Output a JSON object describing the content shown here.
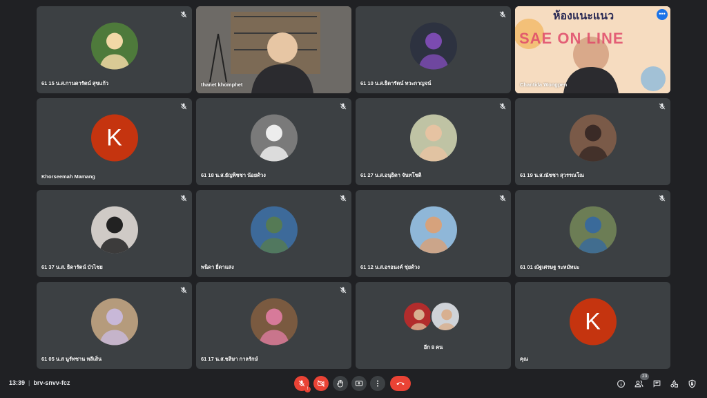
{
  "meeting": {
    "time": "13:39",
    "code": "brv-snvv-fcz"
  },
  "participants": [
    {
      "name": "61 15 น.ส.กานดารัตน์ สุขแก้ว",
      "kind": "photo",
      "bg": "#4e7a3b",
      "fg": "#f2d8a6",
      "muted": true
    },
    {
      "name": "thanet khomphet",
      "kind": "video",
      "bg": "#6d6a66",
      "fg": "#e7c6a4",
      "muted": false
    },
    {
      "name": "61 10 น.ส.ธิดารัตน์ ทวะกาญจน์",
      "kind": "photo",
      "bg": "#2d3240",
      "fg": "#7b4bb0",
      "muted": true
    },
    {
      "name": "Chantida Wongpen",
      "kind": "video",
      "bg": "#f3d6b4",
      "fg": "#d9a98a",
      "muted": false,
      "active": true,
      "banner": "ห้องแนะแนว",
      "banner_sub": "SAE ON LINE"
    },
    {
      "name": "Khorseemah Mamang",
      "kind": "letter",
      "letter": "K",
      "muted": true
    },
    {
      "name": "61 18 น.ส.ธัญพิชชา น้อยด้วง",
      "kind": "photo",
      "bg": "#7a7a7a",
      "fg": "#ededed",
      "muted": true
    },
    {
      "name": "61 27 น.ส.อนุธิดา จันทโชติ",
      "kind": "photo",
      "bg": "#bfc3a4",
      "fg": "#e6c3a2",
      "muted": true
    },
    {
      "name": "61 19 น.ส.ณัชชา สุวรรณโณ",
      "kind": "photo",
      "bg": "#7a5a48",
      "fg": "#3a2a26",
      "muted": true
    },
    {
      "name": "61 37 น.ส. ธิดารัตน์ บัวไชย",
      "kind": "photo",
      "bg": "#cfcac6",
      "fg": "#222222",
      "muted": true
    },
    {
      "name": "พนิดา ยี่ดาแสง",
      "kind": "photo",
      "bg": "#3d6a9a",
      "fg": "#557a55",
      "muted": true
    },
    {
      "name": "61 12 น.ส.อรอนงค์ ชุ่ยด้วง",
      "kind": "photo",
      "bg": "#8fb7d8",
      "fg": "#d6a27c",
      "muted": true
    },
    {
      "name": "61 01 ณัฐเศรษฐ ระหมัทมะ",
      "kind": "photo",
      "bg": "#6c7d55",
      "fg": "#3a6a9a",
      "muted": true
    },
    {
      "name": "61 05 น.ส นูรัทซาน หลีเส็น",
      "kind": "photo",
      "bg": "#b59b7c",
      "fg": "#c8b8d8",
      "muted": true
    },
    {
      "name": "61 17 น.ส.ชลิษา กาลรักษ์",
      "kind": "photo",
      "bg": "#7a5a40",
      "fg": "#d77a9a",
      "muted": true
    },
    {
      "name": "อีก 8 คน",
      "kind": "others",
      "colors": [
        "#b22c2c",
        "#cfd3d8"
      ]
    },
    {
      "name": "คุณ",
      "kind": "letter",
      "letter": "K",
      "muted": false
    }
  ],
  "controls": {
    "mic_badge": "!",
    "participants_count": "23"
  },
  "colors": {
    "accent_red": "#ea4335",
    "tile": "#3c4043",
    "avatar_letter": "#c5340f",
    "active_outline": "#8ab4f8"
  }
}
